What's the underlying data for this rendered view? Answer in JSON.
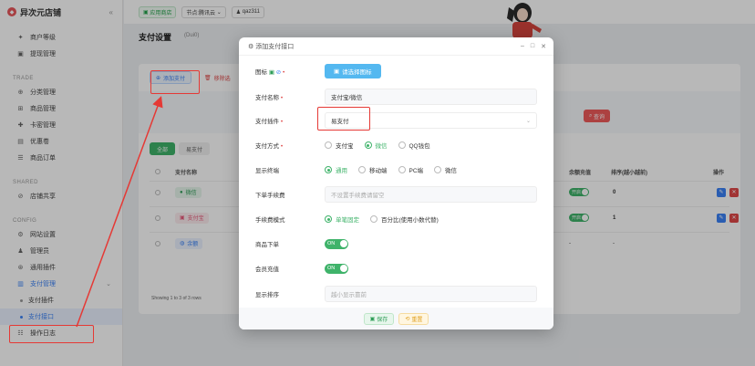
{
  "sidebar": {
    "brand": "异次元店铺",
    "collapse_icon": "«",
    "items_top": [
      {
        "label": "商户等级",
        "icon": "level-icon"
      },
      {
        "label": "提现管理",
        "icon": "withdraw-icon"
      }
    ],
    "section_trade": "TRADE",
    "items_trade": [
      {
        "label": "分类管理"
      },
      {
        "label": "商品管理"
      },
      {
        "label": "卡密管理"
      },
      {
        "label": "优惠卷"
      },
      {
        "label": "商品订单"
      }
    ],
    "section_shared": "SHARED",
    "items_shared": [
      {
        "label": "店铺共享"
      }
    ],
    "section_config": "CONFIG",
    "items_config": [
      {
        "label": "网站设置"
      },
      {
        "label": "管理员"
      },
      {
        "label": "通用插件"
      },
      {
        "label": "支付管理"
      }
    ],
    "sub_items": [
      {
        "label": "支付插件"
      },
      {
        "label": "支付接口"
      }
    ],
    "item_log": "操作日志"
  },
  "topbar": {
    "app_store": "应用商店",
    "node": "节点:腾讯云",
    "user": "qaz311"
  },
  "page": {
    "title": "支付设置",
    "subtitle": "(Dui0)",
    "add_button": "添加支付",
    "delete_button": "移除选",
    "query_button": "查询",
    "tabs": [
      "全部",
      "易支付"
    ],
    "table_headers": [
      "支付名称",
      "余额充值",
      "排序(越小越前)",
      "操作"
    ],
    "rows": [
      {
        "name": "微信",
        "color": "#2eae5d",
        "recharge": "开启",
        "sort": "0"
      },
      {
        "name": "支付宝",
        "color": "#e85a7a",
        "recharge": "开启",
        "sort": "1"
      },
      {
        "name": "余额",
        "color": "#3b82f6",
        "recharge": "-",
        "sort": "-"
      }
    ],
    "footer_note": "Showing 1 to 3 of 3 rows"
  },
  "modal": {
    "title": "添加支付接口",
    "fields": {
      "icon_label": "图标",
      "upload_button": "请选择图标",
      "name_label": "支付名称",
      "name_value": "支付宝/微信",
      "plugin_label": "支付插件",
      "plugin_value": "易支付",
      "method_label": "支付方式",
      "method_options": [
        "支付宝",
        "微信",
        "QQ钱包"
      ],
      "method_selected": 1,
      "terminal_label": "显示终端",
      "terminal_options": [
        "通用",
        "移动端",
        "PC端",
        "微信"
      ],
      "fee_label": "下单手续费",
      "fee_placeholder": "不设置手续费请留空",
      "fee_mode_label": "手续费模式",
      "fee_mode_options": [
        "单笔固定",
        "百分比(使用小数代替)"
      ],
      "order_label": "商品下单",
      "order_toggle": "ON",
      "member_label": "会员充值",
      "member_toggle": "ON",
      "sort_label": "显示排序",
      "sort_placeholder": "越小显示靠前"
    },
    "save_button": "保存",
    "reset_button": "重置"
  },
  "colors": {
    "accent_green": "#3fb36a",
    "accent_blue": "#3b82f6",
    "annotation_red": "#e53935"
  }
}
